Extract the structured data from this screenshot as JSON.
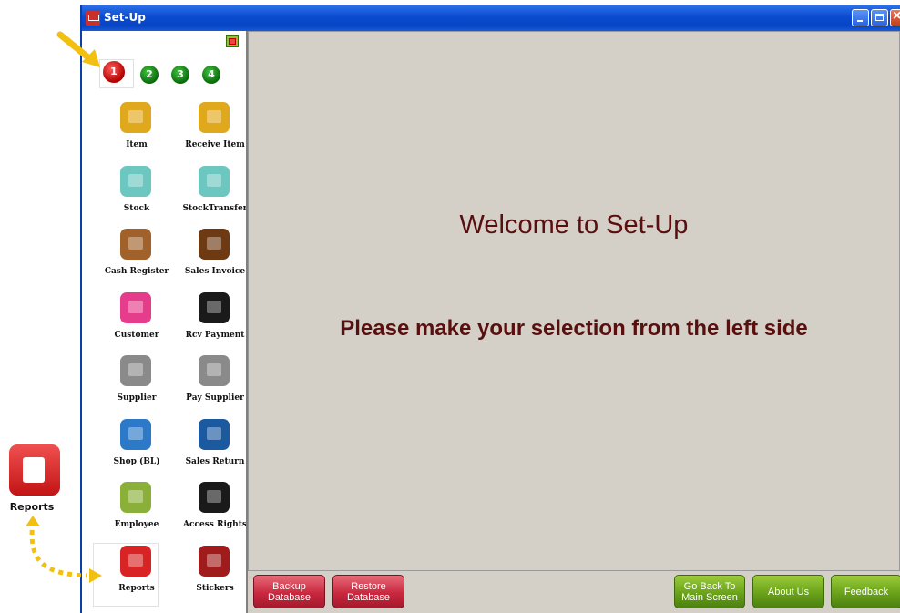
{
  "window": {
    "title": "Set-Up"
  },
  "sidebar": {
    "pages": [
      "1",
      "2",
      "3",
      "4"
    ],
    "active_page": "1",
    "tiles": [
      {
        "label": "Item",
        "icon": "shopping-cart-icon",
        "color": "#e0a81c"
      },
      {
        "label": "Receive Item",
        "icon": "delivery-truck-icon",
        "color": "#e0a81c"
      },
      {
        "label": "Stock",
        "icon": "hand-truck-icon",
        "color": "#6cc7c0"
      },
      {
        "label": "StockTransfer",
        "icon": "boxes-transfer-icon",
        "color": "#6cc7c0"
      },
      {
        "label": "Cash Register",
        "icon": "cash-register-icon",
        "color": "#a0622a"
      },
      {
        "label": "Sales Invoice",
        "icon": "invoice-pen-icon",
        "color": "#6e3a14"
      },
      {
        "label": "Customer",
        "icon": "customers-icon",
        "color": "#e63c8c"
      },
      {
        "label": "Rcv Payment",
        "icon": "payment-box-icon",
        "color": "#1a1a1a"
      },
      {
        "label": "Supplier",
        "icon": "factory-icon",
        "color": "#8a8a8a"
      },
      {
        "label": "Pay Supplier",
        "icon": "factory-arrow-icon",
        "color": "#8a8a8a"
      },
      {
        "label": "Shop (BL)",
        "icon": "shop-icon",
        "color": "#2c79c8"
      },
      {
        "label": "Sales Return",
        "icon": "cart-return-icon",
        "color": "#1c5aa0"
      },
      {
        "label": "Employee",
        "icon": "employee-icon",
        "color": "#8ab03a"
      },
      {
        "label": "Access Rights",
        "icon": "lock-key-icon",
        "color": "#1a1a1a"
      },
      {
        "label": "Reports",
        "icon": "scroll-report-icon",
        "color": "#d82424"
      },
      {
        "label": "Stickers",
        "icon": "barcode-sticker-icon",
        "color": "#a01c1c"
      }
    ]
  },
  "main": {
    "welcome": "Welcome to Set-Up",
    "prompt": "Please make your selection from the left side"
  },
  "footer": {
    "backup": "Backup Database",
    "restore": "Restore Database",
    "go_back": "Go Back To Main Screen",
    "about": "About Us",
    "feedback": "Feedback"
  },
  "callout": {
    "reports_label": "Reports"
  }
}
